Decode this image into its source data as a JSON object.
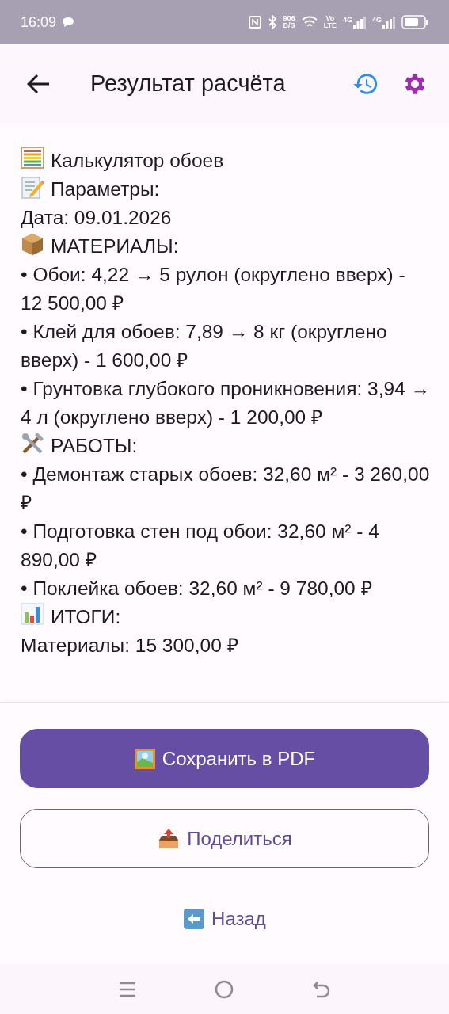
{
  "status_bar": {
    "time": "16:09",
    "speed_value": "906",
    "speed_unit": "B/S",
    "volte_top": "Vo",
    "volte_bottom": "LTE",
    "networks": [
      "4G",
      "4G"
    ]
  },
  "app_bar": {
    "title": "Результат расчёта"
  },
  "result_lines": [
    {
      "kind": "heading",
      "text": "Калькулятор обоев"
    },
    {
      "kind": "heading",
      "text": "Параметры:"
    },
    {
      "kind": "plain",
      "text": "Дата: 09.01.2026"
    },
    {
      "kind": "heading",
      "text": "МАТЕРИАЛЫ:"
    },
    {
      "kind": "plain",
      "text": "• Обои: 4,22 → 5 рулон (округлено вверх) - 12 500,00 ₽"
    },
    {
      "kind": "plain",
      "text": "• Клей для обоев: 7,89 → 8 кг (округлено вверх) - 1 600,00 ₽"
    },
    {
      "kind": "plain",
      "text": "• Грунтовка глубокого проникновения: 3,94 → 4 л (округлено вверх) - 1 200,00 ₽"
    },
    {
      "kind": "heading",
      "text": "РАБОТЫ:"
    },
    {
      "kind": "plain",
      "text": "• Демонтаж старых обоев: 32,60 м² - 3 260,00 ₽"
    },
    {
      "kind": "plain",
      "text": "• Подготовка стен под обои: 32,60 м² - 4 890,00 ₽"
    },
    {
      "kind": "plain",
      "text": "• Поклейка обоев: 32,60 м² - 9 780,00 ₽"
    },
    {
      "kind": "heading",
      "text": "ИТОГИ:"
    },
    {
      "kind": "plain",
      "text": "Материалы: 15 300,00 ₽"
    }
  ],
  "actions": [
    {
      "kind": "filled",
      "label": "Сохранить в PDF"
    },
    {
      "kind": "outlined",
      "label": "Поделиться"
    },
    {
      "kind": "text",
      "label": "Назад"
    }
  ]
}
